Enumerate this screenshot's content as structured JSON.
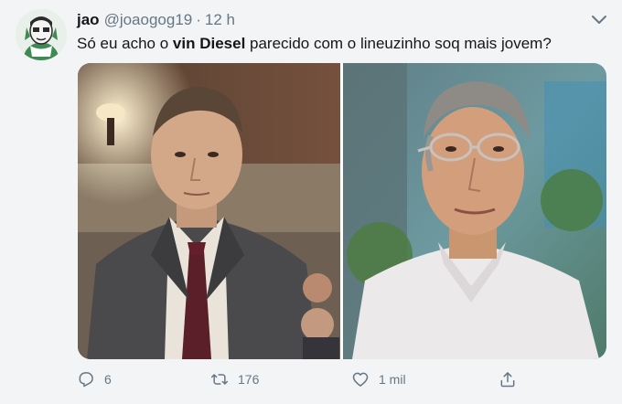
{
  "tweet": {
    "author_name": "jao",
    "author_handle": "@joaogog19",
    "separator": "·",
    "time": "12 h",
    "text_before": "Só eu acho o ",
    "text_bold": "vin Diesel",
    "text_after": " parecido com o lineuzinho soq mais jovem?"
  },
  "actions": {
    "reply_count": "6",
    "retweet_count": "176",
    "like_count": "1 mil"
  },
  "icons": {
    "reply": "reply-icon",
    "retweet": "retweet-icon",
    "like": "heart-icon",
    "share": "share-icon",
    "menu": "chevron-down-icon"
  },
  "colors": {
    "background": "#f2f4f5",
    "text": "#14171a",
    "secondary": "#657786"
  }
}
